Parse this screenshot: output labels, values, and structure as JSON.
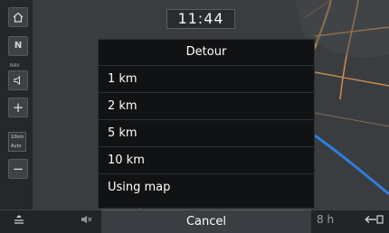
{
  "clock": {
    "time": "11:44"
  },
  "side_controls": {
    "home_icon": "home-icon",
    "north_badge": "N",
    "nav_caption": "NAV",
    "volume_icon": "speaker-icon",
    "zoom_in": "+",
    "scale_top": "10km",
    "scale_bottom": "Auto",
    "zoom_out": "−"
  },
  "detour": {
    "title": "Detour",
    "options": [
      "1 km",
      "2 km",
      "5 km",
      "10 km",
      "Using map"
    ],
    "cancel_label": "Cancel"
  },
  "bottom_bar": {
    "menu_icon": "menu-icon",
    "mute_icon": "mute-icon",
    "distance_fragment": "8 h",
    "back_icon": "back-arrow-icon"
  },
  "colors": {
    "map_background": "#3a3d40",
    "route": "#2f7de0",
    "roads": "#c88a4e",
    "popup_background": "#111213"
  }
}
